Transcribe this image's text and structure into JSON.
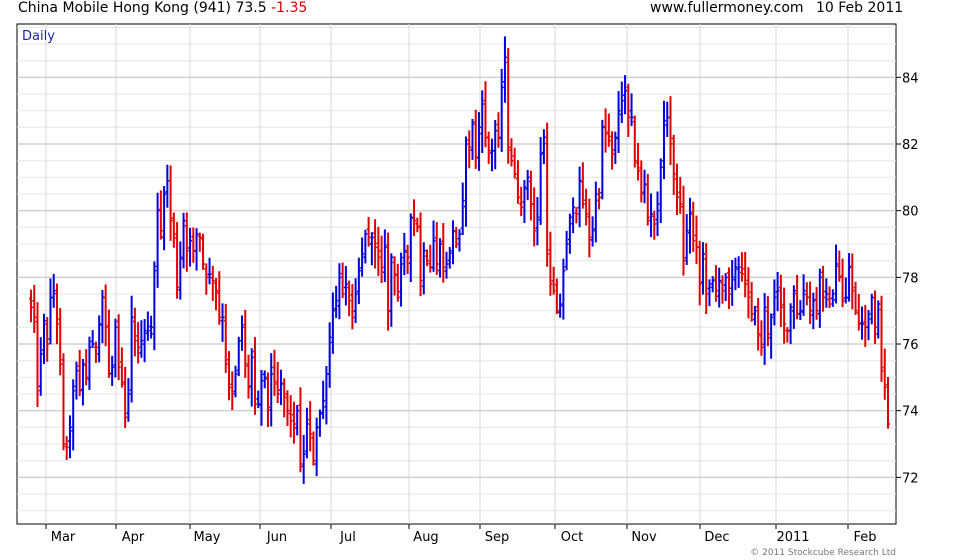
{
  "header": {
    "title": "China Mobile Hong Kong (941)",
    "last_price": "73.5",
    "change": "-1.35",
    "source": "www.fullermoney.com",
    "date": "10 Feb 2011"
  },
  "footer": {
    "copyright": "© 2011 Stockcube Research Ltd"
  },
  "colors": {
    "up": "#0000e0",
    "down": "#e00000",
    "grid": "#c8c8c8",
    "period_label": "#2222aa"
  },
  "chart_data": {
    "type": "bar",
    "title": "China Mobile Hong Kong (941) 73.5 -1.35",
    "period_label": "Daily",
    "ylim": [
      70.6,
      85.6
    ],
    "y_ticks": [
      72,
      74,
      76,
      78,
      80,
      82,
      84
    ],
    "y_axis_side": "right",
    "grid": true,
    "x_labels": [
      "Mar",
      "Apr",
      "May",
      "Jun",
      "Jul",
      "Aug",
      "Sep",
      "Oct",
      "Nov",
      "Dec",
      "2011",
      "Feb"
    ],
    "series": [
      {
        "values": [
          77.1,
          76.8,
          74.6,
          75.7,
          76.7,
          76.0,
          77.4,
          77.6,
          76.6,
          75.4,
          73.0,
          72.9,
          73.5,
          74.6,
          75.2,
          74.6,
          75.4,
          75.0,
          75.9,
          76.0,
          75.9,
          76.6,
          77.4,
          76.5,
          75.1,
          75.3,
          76.5,
          75.3,
          74.8,
          73.8,
          74.5,
          76.8,
          76.1,
          75.9,
          76.1,
          76.4,
          76.4,
          76.5,
          78.2,
          80.0,
          79.4,
          80.5,
          80.9,
          79.7,
          79.3,
          77.7,
          78.6,
          79.7,
          78.8,
          79.1,
          78.8,
          79.3,
          79.2,
          78.4,
          78.0,
          78.1,
          77.9,
          77.6,
          76.8,
          76.8,
          75.4,
          74.7,
          74.5,
          75.1,
          76.1,
          76.5,
          75.4,
          74.7,
          75.6,
          74.2,
          74.2,
          74.9,
          75.0,
          74.1,
          75.1,
          74.8,
          74.5,
          74.8,
          74.4,
          74.0,
          73.7,
          73.6,
          74.0,
          72.4,
          72.7,
          73.6,
          73.3,
          72.5,
          73.5,
          73.9,
          74.3,
          75.1,
          76.2,
          77.0,
          77.3,
          78.0,
          77.5,
          77.8,
          77.3,
          76.8,
          77.5,
          78.2,
          78.7,
          79.3,
          79.2,
          79.2,
          78.9,
          78.6,
          78.3,
          78.9,
          77.0,
          78.6,
          78.1,
          77.4,
          78.4,
          78.8,
          78.6,
          79.8,
          79.7,
          79.5,
          77.9,
          78.8,
          78.5,
          78.3,
          79.1,
          78.4,
          79.0,
          78.3,
          78.4,
          78.8,
          79.4,
          79.0,
          79.3,
          80.3,
          82.0,
          81.9,
          82.6,
          81.6,
          82.5,
          83.2,
          82.2,
          81.8,
          81.8,
          82.4,
          82.2,
          83.7,
          84.6,
          81.9,
          81.5,
          81.1,
          80.4,
          80.1,
          80.7,
          81.0,
          80.2,
          79.4,
          79.8,
          81.7,
          82.2,
          78.7,
          77.8,
          77.6,
          77.0,
          77.2,
          78.2,
          79.0,
          79.8,
          80.1,
          79.9,
          80.9,
          80.2,
          79.9,
          79.2,
          79.4,
          80.5,
          80.4,
          82.5,
          82.3,
          82.1,
          81.7,
          82.2,
          83.0,
          83.3,
          83.6,
          82.8,
          82.8,
          81.5,
          81.2,
          80.5,
          80.8,
          79.8,
          79.9,
          79.6,
          80.2,
          81.3,
          82.7,
          82.8,
          82.0,
          81.1,
          80.4,
          80.2,
          78.5,
          79.4,
          79.9,
          79.1,
          78.9,
          77.8,
          78.7,
          77.5,
          77.7,
          77.9,
          77.6,
          77.9,
          77.6,
          78.0,
          77.5,
          78.0,
          78.3,
          78.3,
          78.1,
          77.8,
          77.4,
          76.9,
          77.0,
          76.3,
          75.9,
          77.1,
          76.3,
          76.8,
          77.4,
          77.6,
          77.1,
          76.6,
          76.4,
          77.1,
          77.6,
          76.9,
          77.0,
          77.6,
          77.4,
          77.0,
          77.3,
          77.0,
          78.0,
          77.4,
          77.5,
          77.2,
          77.5,
          78.4,
          78.0,
          77.3,
          77.4,
          78.3,
          77.6,
          77.0,
          76.6,
          76.6,
          76.5,
          76.9,
          77.4,
          76.5,
          77.2,
          75.2,
          74.7,
          73.6
        ]
      }
    ]
  }
}
